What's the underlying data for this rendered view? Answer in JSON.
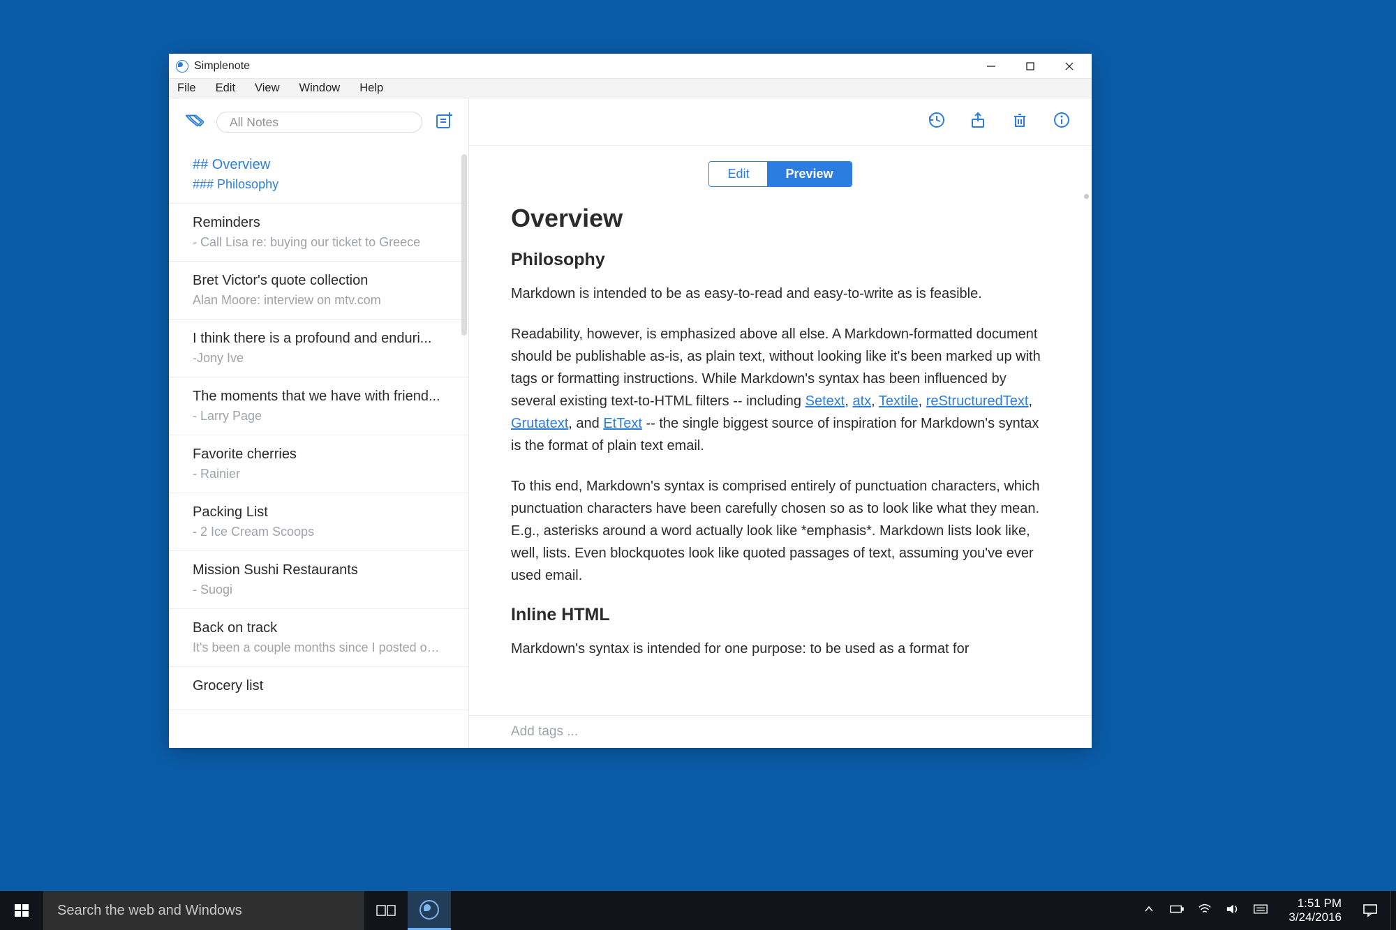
{
  "window": {
    "title": "Simplenote"
  },
  "menubar": [
    "File",
    "Edit",
    "View",
    "Window",
    "Help"
  ],
  "sidebar": {
    "search_placeholder": "All Notes",
    "notes": [
      {
        "title": "## Overview",
        "sub": "### Philosophy",
        "selected": true
      },
      {
        "title": "Reminders",
        "sub": "- Call Lisa re: buying our ticket to Greece",
        "selected": false
      },
      {
        "title": "Bret Victor's quote collection",
        "sub": "Alan Moore: interview on mtv.com",
        "selected": false
      },
      {
        "title": "I think there is a profound and enduri...",
        "sub": "-Jony Ive",
        "selected": false
      },
      {
        "title": "The moments that we have with friend...",
        "sub": "- Larry Page",
        "selected": false
      },
      {
        "title": "Favorite cherries",
        "sub": "- Rainier",
        "selected": false
      },
      {
        "title": "Packing List",
        "sub": "- 2 Ice Cream Scoops",
        "selected": false
      },
      {
        "title": "Mission Sushi Restaurants",
        "sub": "- Suogi",
        "selected": false
      },
      {
        "title": "Back on track",
        "sub": "It's been a couple months since I posted on ...",
        "selected": false
      },
      {
        "title": "Grocery list",
        "sub": "",
        "selected": false
      }
    ]
  },
  "segmented": {
    "edit": "Edit",
    "preview": "Preview",
    "active": "preview"
  },
  "doc": {
    "h1": "Overview",
    "h2a": "Philosophy",
    "p1": "Markdown is intended to be as easy-to-read and easy-to-write as is feasible.",
    "p2_start": "Readability, however, is emphasized above all else. A Markdown-formatted document should be publishable as-is, as plain text, without looking like it's been marked up with tags or formatting instructions. While Markdown's syntax has been influenced by several existing text-to-HTML filters -- including ",
    "links": {
      "setext": "Setext",
      "atx": "atx",
      "textile": "Textile",
      "rst": "reStructuredText",
      "grutatext": "Grutatext",
      "ettext": "EtText"
    },
    "p2_mid": ", and ",
    "p2_end": " -- the single biggest source of inspiration for Markdown's syntax is the format of plain text email.",
    "p3": "To this end, Markdown's syntax is comprised entirely of punctuation characters, which punctuation characters have been carefully chosen so as to look like what they mean. E.g., asterisks around a word actually look like *emphasis*. Markdown lists look like, well, lists. Even blockquotes look like quoted passages of text, assuming you've ever used email.",
    "h2b": "Inline HTML",
    "p4": "Markdown's syntax is intended for one purpose: to be used as a format for",
    "tag_placeholder": "Add tags ..."
  },
  "taskbar": {
    "search_placeholder": "Search the web and Windows",
    "time": "1:51 PM",
    "date": "3/24/2016"
  }
}
